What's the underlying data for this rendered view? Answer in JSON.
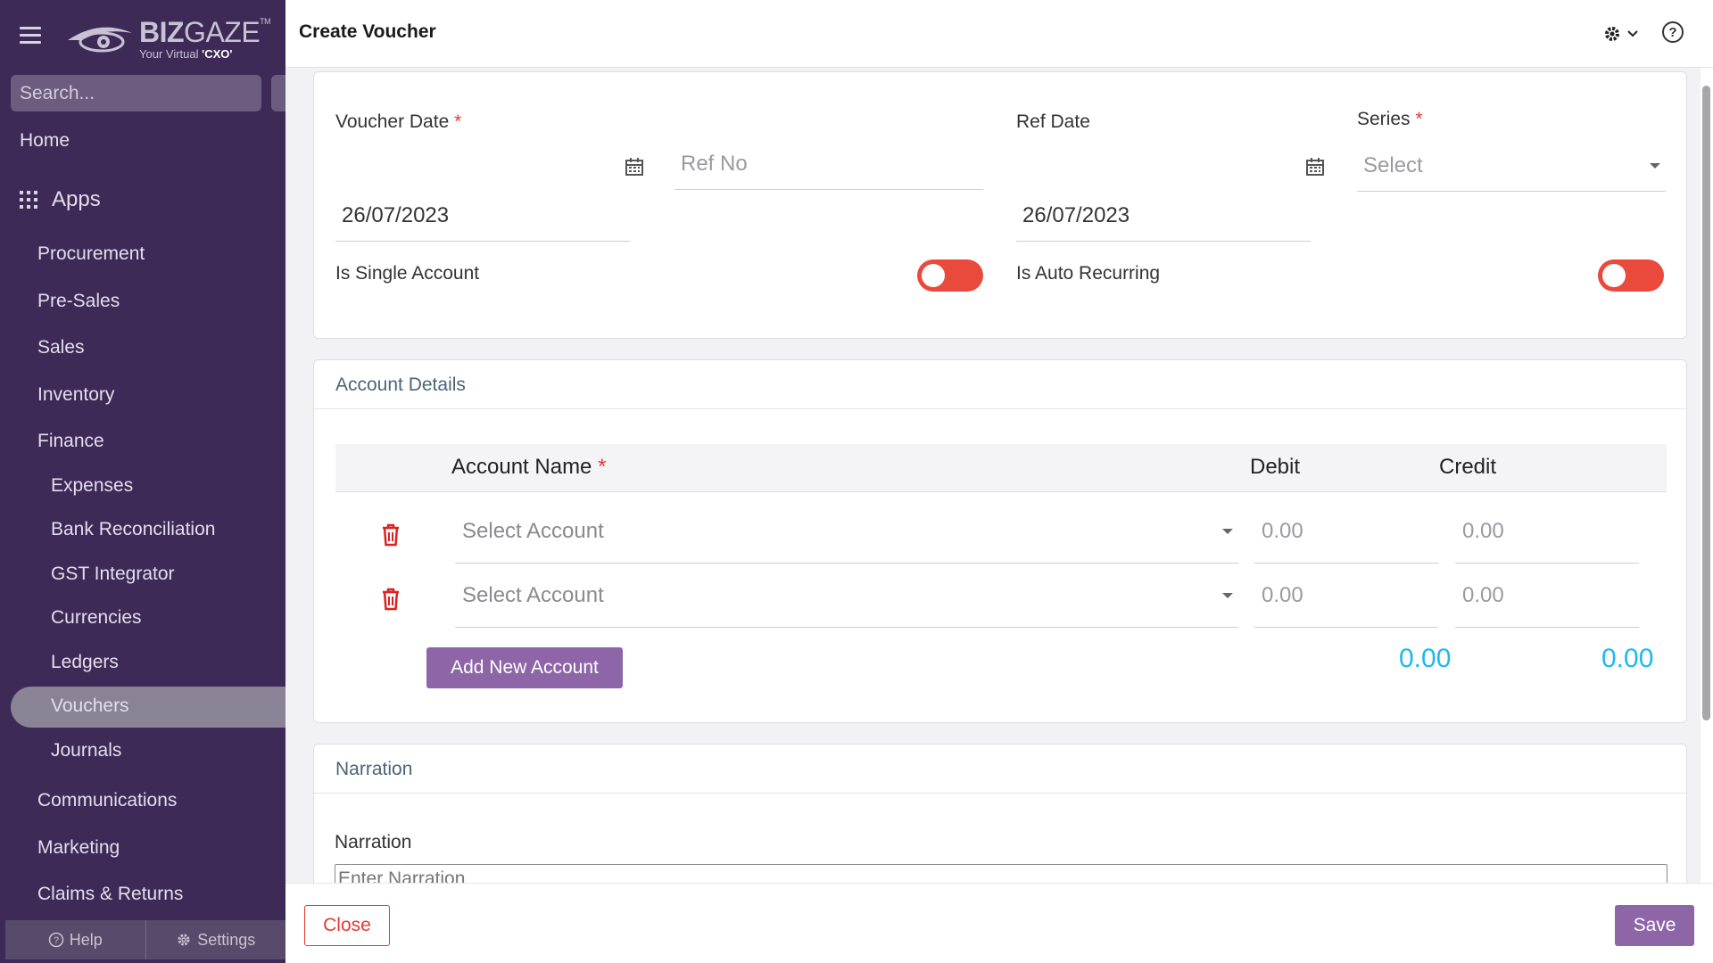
{
  "logo": {
    "brand_bold": "BIZ",
    "brand_light": "GAZE",
    "tm": "TM",
    "tagline_prefix": "Your Virtual ",
    "tagline_bold": "'CXO'"
  },
  "search": {
    "placeholder": "Search..."
  },
  "nav": {
    "home": "Home",
    "apps": "Apps",
    "items": [
      "Procurement",
      "Pre-Sales",
      "Sales",
      "Inventory",
      "Finance"
    ],
    "finance_sub": [
      "Expenses",
      "Bank Reconciliation",
      "GST Integrator",
      "Currencies",
      "Ledgers",
      "Vouchers",
      "Journals"
    ],
    "after": [
      "Communications",
      "Marketing",
      "Claims & Returns"
    ],
    "active": "Vouchers"
  },
  "footer": {
    "help": "Help",
    "settings": "Settings"
  },
  "header": {
    "title": "Create Voucher",
    "help_symbol": "?"
  },
  "form": {
    "voucher_date": {
      "label": "Voucher Date",
      "value": "26/07/2023"
    },
    "ref_no": {
      "placeholder": "Ref No"
    },
    "ref_date": {
      "label": "Ref Date",
      "value": "26/07/2023"
    },
    "series": {
      "label": "Series",
      "placeholder": "Select"
    },
    "is_single_account": {
      "label": "Is Single Account",
      "on": false
    },
    "is_auto_recurring": {
      "label": "Is Auto Recurring",
      "on": false
    },
    "required_mark": "*"
  },
  "account_details": {
    "title": "Account Details",
    "columns": {
      "account_name": "Account Name",
      "debit": "Debit",
      "credit": "Credit"
    },
    "rows": [
      {
        "account_placeholder": "Select Account",
        "debit": "0.00",
        "credit": "0.00"
      },
      {
        "account_placeholder": "Select Account",
        "debit": "0.00",
        "credit": "0.00"
      }
    ],
    "add_button": "Add New Account",
    "total_debit": "0.00",
    "total_credit": "0.00"
  },
  "narration": {
    "section_title": "Narration",
    "label": "Narration",
    "placeholder": "Enter Narration"
  },
  "actions": {
    "close": "Close",
    "save": "Save"
  },
  "colors": {
    "sidebar": "#3e2a56",
    "primary": "#8e66a8",
    "toggle_off": "#ea4a3c",
    "danger": "#e53935",
    "total": "#1eb8f0"
  }
}
